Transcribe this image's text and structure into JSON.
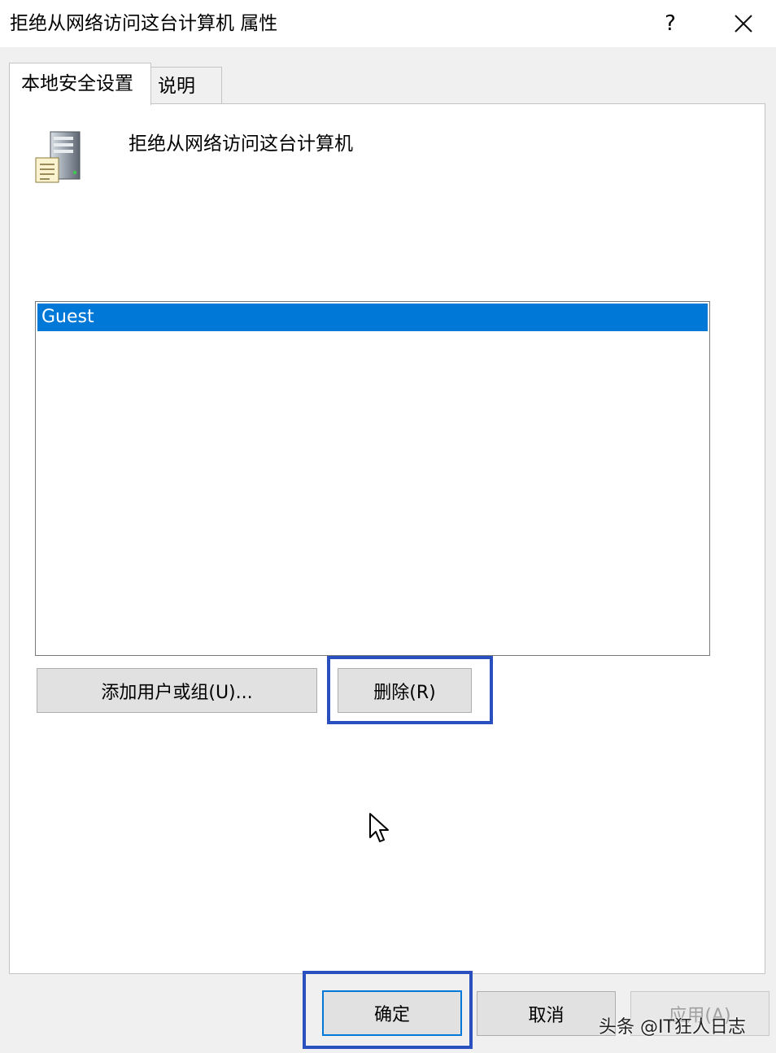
{
  "window": {
    "title": "拒绝从网络访问这台计算机 属性",
    "help_label": "?",
    "close_icon": "close-icon"
  },
  "tabs": [
    {
      "label": "本地安全设置",
      "active": true
    },
    {
      "label": "说明",
      "active": false
    }
  ],
  "policy": {
    "name": "拒绝从网络访问这台计算机",
    "icon": "server-policy-icon"
  },
  "accounts": {
    "items": [
      {
        "label": "Guest",
        "selected": true
      }
    ]
  },
  "actions": {
    "add_label": "添加用户或组(U)...",
    "remove_label": "删除(R)"
  },
  "footer": {
    "ok_label": "确定",
    "cancel_label": "取消",
    "apply_label": "应用(A)",
    "apply_enabled": false
  },
  "watermark": "头条 @IT狂人日志",
  "colors": {
    "selection": "#0078d7",
    "highlight_box": "#2a4fbf",
    "dialog_bg": "#f0f0f0"
  }
}
